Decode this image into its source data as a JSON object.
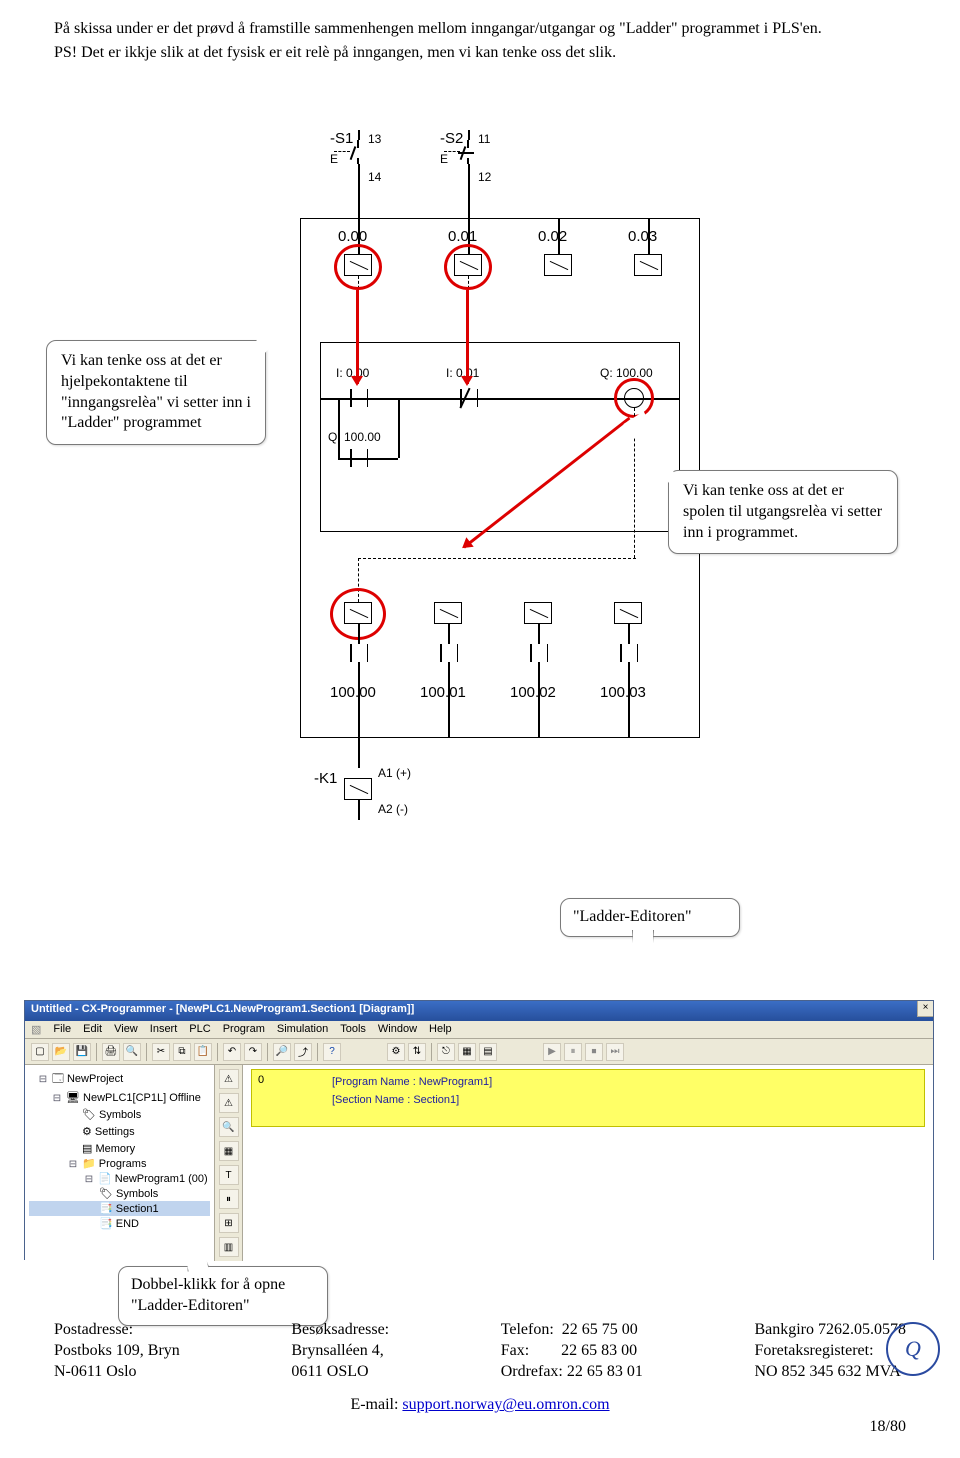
{
  "body_text": {
    "p1": "På skissa under er det prøvd å framstille sammenhengen mellom inngangar/utgangar og \"Ladder\" programmet i PLS'en.",
    "p2": "PS! Det er ikkje slik at det fysisk er eit relè på inngangen, men vi kan tenke oss det slik."
  },
  "diagram_labels": {
    "s1": "-S1",
    "s1_pin_a": "13",
    "s1_pin_b": "14",
    "s1_e": "E",
    "s2": "-S2",
    "s2_pin_a": "11",
    "s2_pin_b": "12",
    "s2_e": "E",
    "in0": "0.00",
    "in1": "0.01",
    "in2": "0.02",
    "in3": "0.03",
    "i0": "I: 0.00",
    "i1": "I: 0.01",
    "q100": "Q: 100.00",
    "q100b": "Q: 100.00",
    "out0": "100.00",
    "out1": "100.01",
    "out2": "100.02",
    "out3": "100.03",
    "k1": "-K1",
    "k1_a1": "A1 (+)",
    "k1_a2": "A2 (-)"
  },
  "callouts": {
    "input_relay": "Vi kan tenke oss at det er hjelpekontaktene til \"inngangsrelèa\" vi setter inn i \"Ladder\" programmet",
    "output_coil": "Vi kan tenke oss at det er spolen til utgangsrelèa vi setter inn i programmet.",
    "ladder_editor": "\"Ladder-Editoren\"",
    "double_click": "Dobbel-klikk for å opne \"Ladder-Editoren\""
  },
  "app": {
    "title": "Untitled - CX-Programmer - [NewPLC1.NewProgram1.Section1 [Diagram]]",
    "menu": [
      "File",
      "Edit",
      "View",
      "Insert",
      "PLC",
      "Program",
      "Simulation",
      "Tools",
      "Window",
      "Help"
    ],
    "tree": {
      "root": "NewProject",
      "plc": "NewPLC1[CP1L] Offline",
      "symbols": "Symbols",
      "settings": "Settings",
      "memory": "Memory",
      "programs": "Programs",
      "program": "NewProgram1 (00)",
      "prog_symbols": "Symbols",
      "section": "Section1",
      "end": "END"
    },
    "rung_number": "0",
    "program_name": "[Program Name : NewProgram1]",
    "section_name": "[Section Name : Section1]"
  },
  "footer": {
    "col1": {
      "h": "Postadresse:",
      "l1": "Postboks 109, Bryn",
      "l2": "N-0611 Oslo"
    },
    "col2": {
      "h": "Besøksadresse:",
      "l1": "Brynsalléen 4,",
      "l2": "0611 OSLO"
    },
    "col3": {
      "l1a": "Telefon:",
      "l1b": "22 65 75 00",
      "l2a": "Fax:",
      "l2b": "22 65 83 00",
      "l3a": "Ordrefax:",
      "l3b": "22 65 83 01"
    },
    "col4": {
      "l1": "Bankgiro 7262.05.0578",
      "l2": "Foretaksregisteret:",
      "l3": "NO 852 345 632 MVA"
    },
    "email_label": "E-mail: ",
    "email": "support.norway@eu.omron.com",
    "page": "18/80"
  }
}
